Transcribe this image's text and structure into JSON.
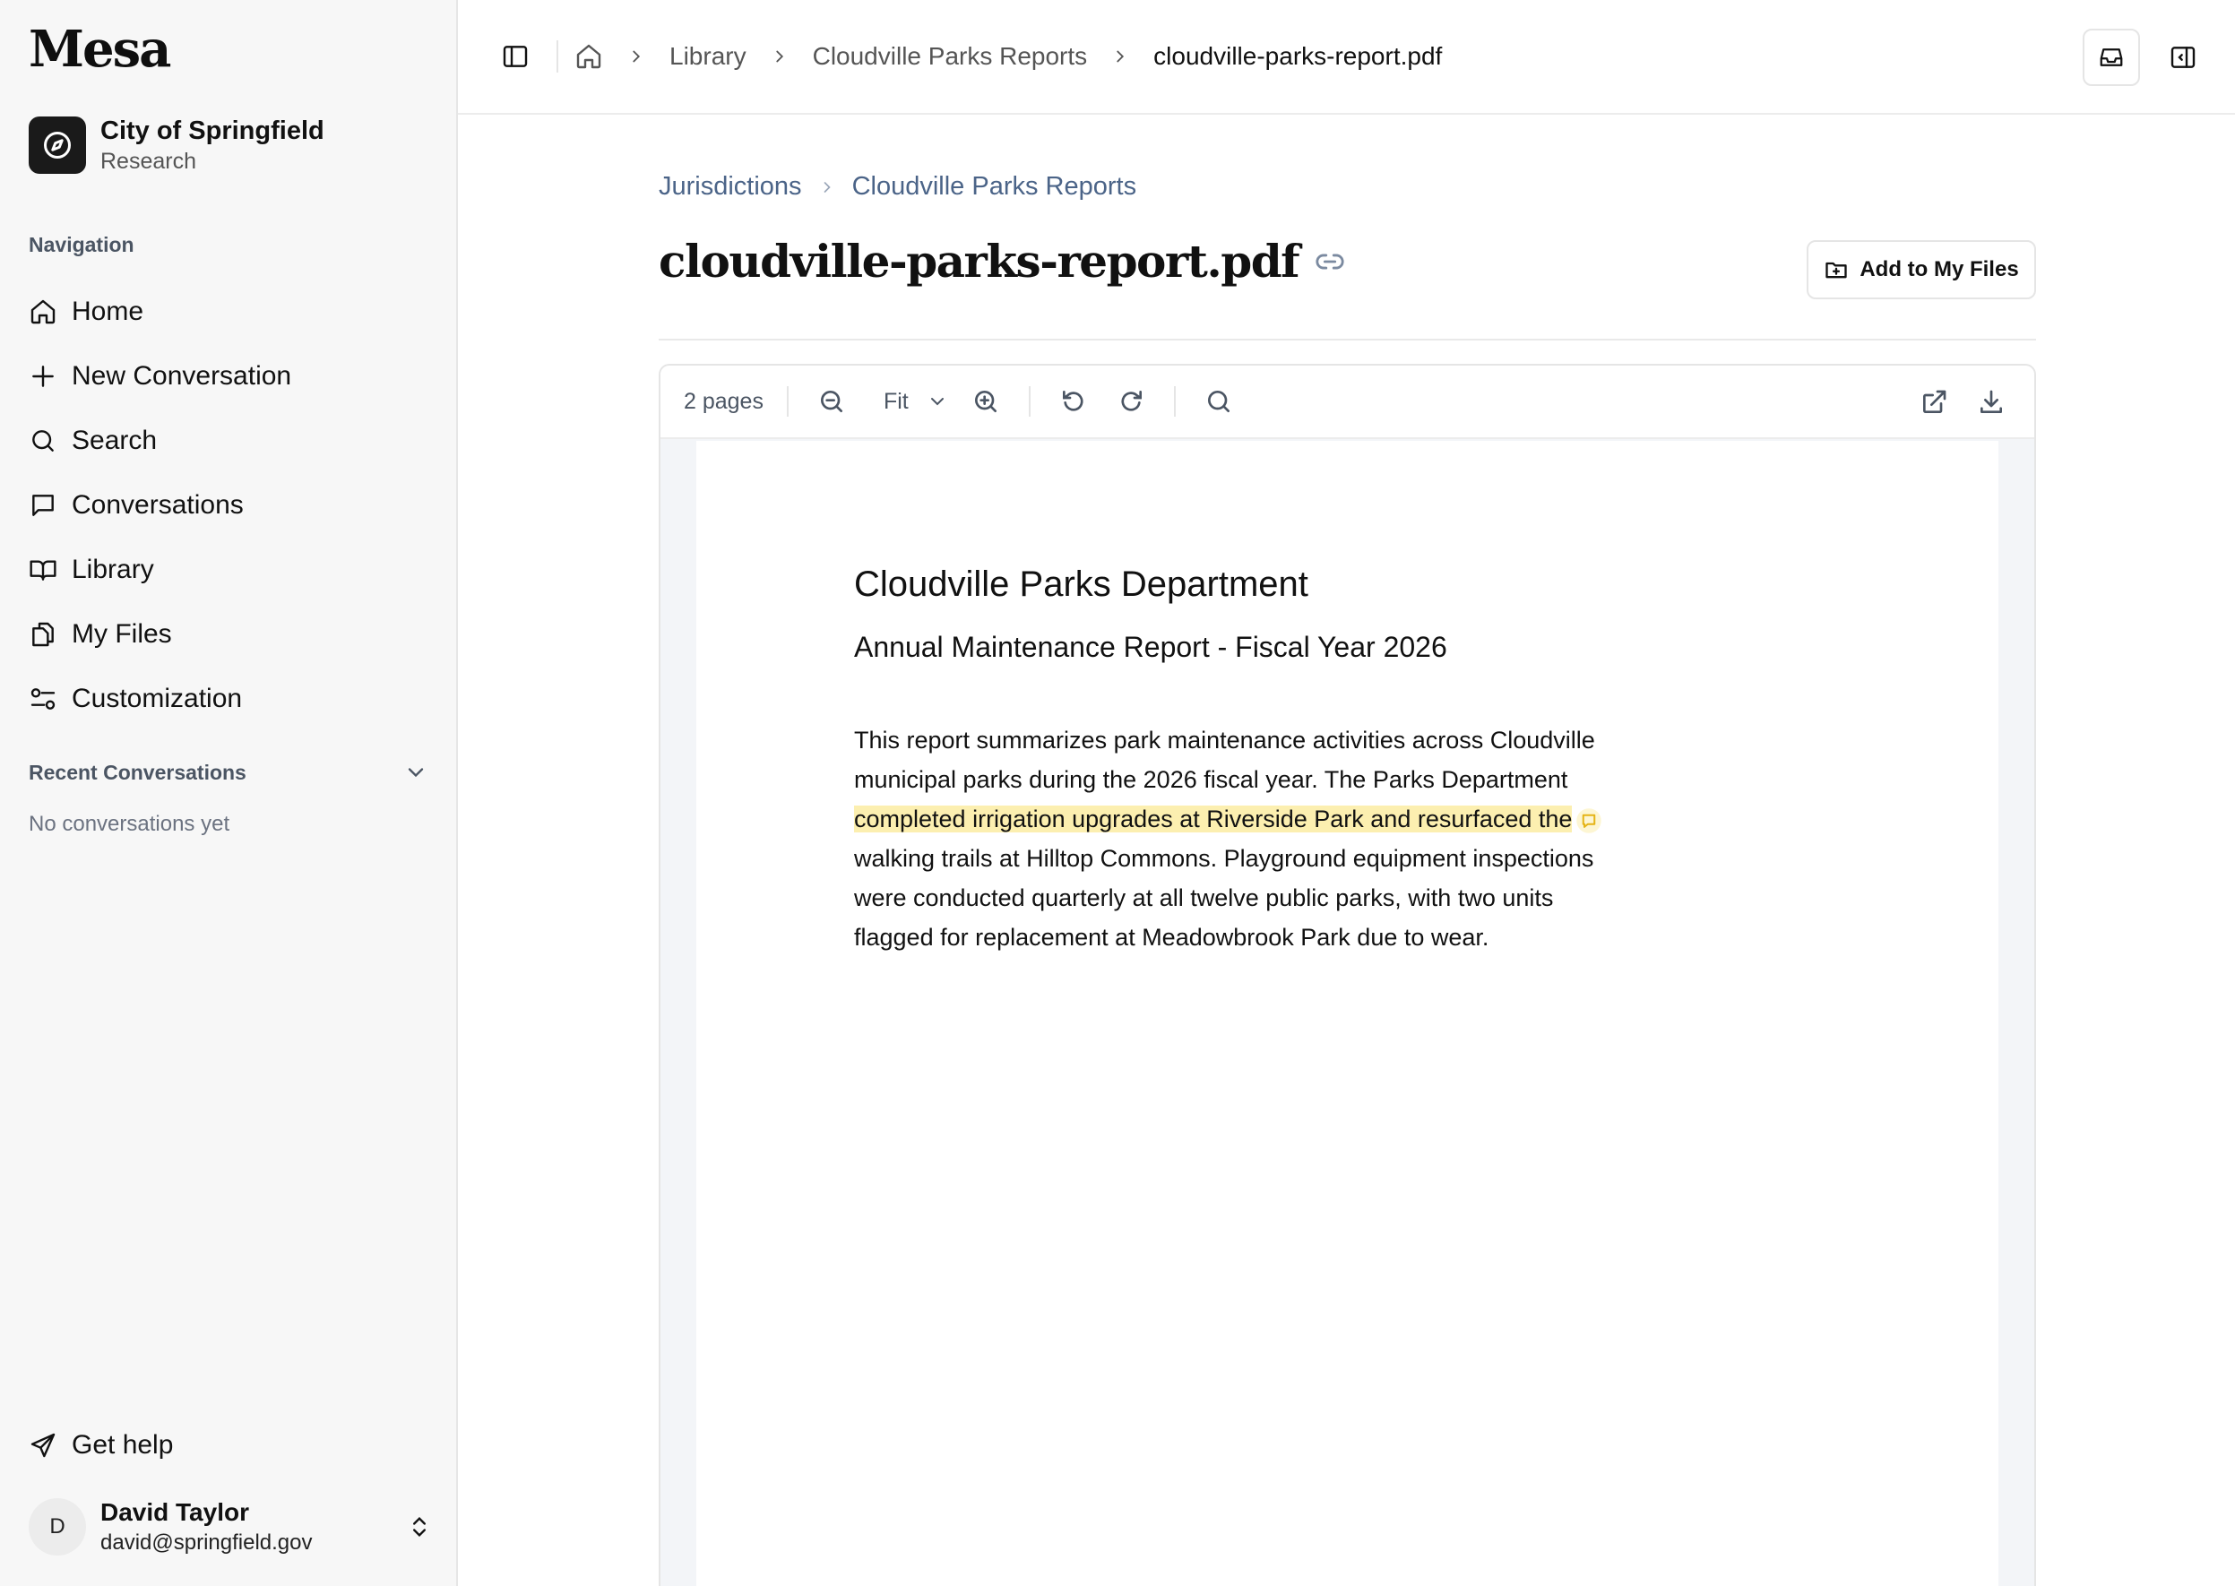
{
  "app": {
    "logo": "Mesa",
    "org_name": "City of Springfield",
    "org_sub": "Research"
  },
  "sidebar": {
    "nav_label": "Navigation",
    "items": [
      {
        "label": "Home",
        "icon": "home-icon"
      },
      {
        "label": "New Conversation",
        "icon": "plus-icon"
      },
      {
        "label": "Search",
        "icon": "search-icon"
      },
      {
        "label": "Conversations",
        "icon": "chat-icon"
      },
      {
        "label": "Library",
        "icon": "book-icon"
      },
      {
        "label": "My Files",
        "icon": "files-icon"
      },
      {
        "label": "Customization",
        "icon": "sliders-icon"
      }
    ],
    "recent_label": "Recent Conversations",
    "recent_empty": "No conversations yet",
    "help_label": "Get help",
    "user": {
      "initial": "D",
      "name": "David Taylor",
      "email": "david@springfield.gov"
    }
  },
  "topbar": {
    "breadcrumbs": [
      "Library",
      "Cloudville Parks Reports",
      "cloudville-parks-report.pdf"
    ]
  },
  "main": {
    "breadcrumbs": [
      "Jurisdictions",
      "Cloudville Parks Reports"
    ],
    "title": "cloudville-parks-report.pdf",
    "add_button": "Add to My Files"
  },
  "viewer": {
    "pages": "2 pages",
    "zoom": "Fit"
  },
  "document": {
    "heading": "Cloudville Parks Department",
    "subheading": "Annual Maintenance Report - Fiscal Year 2026",
    "body_before": "This report summarizes park maintenance activities across Cloudville municipal parks during the 2026 fiscal year. The Parks Department ",
    "body_highlight": "completed irrigation upgrades at Riverside Park and resurfaced the",
    "body_after": " walking trails at Hilltop Commons. Playground equipment inspections were conducted quarterly at all twelve public parks, with two units flagged for replacement at Meadowbrook Park due to wear.",
    "highlight_color": "#fcefb0"
  }
}
